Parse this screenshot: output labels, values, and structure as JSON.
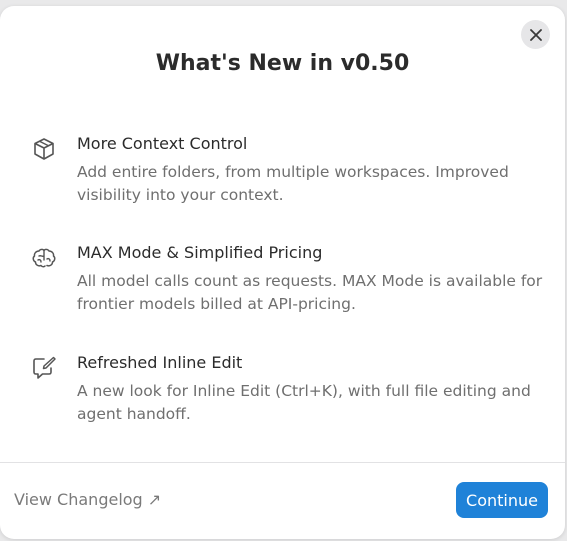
{
  "dialog": {
    "title": "What's New in v0.50",
    "close_icon": "close-icon",
    "features": [
      {
        "icon": "cube-icon",
        "title": "More Context Control",
        "description": "Add entire folders, from multiple workspaces. Improved visibility into your context."
      },
      {
        "icon": "brain-icon",
        "title": "MAX Mode & Simplified Pricing",
        "description": "All model calls count as requests. MAX Mode is available for frontier models billed at API-pricing."
      },
      {
        "icon": "edit-bubble-icon",
        "title": "Refreshed Inline Edit",
        "description": "A new look for Inline Edit (Ctrl+K), with full file editing and agent handoff."
      }
    ],
    "footer": {
      "changelog_label": "View Changelog ↗",
      "continue_label": "Continue"
    },
    "colors": {
      "accent": "#1f82d8",
      "title_text": "#2b2b2b",
      "secondary_text": "#6f6f6f"
    }
  }
}
